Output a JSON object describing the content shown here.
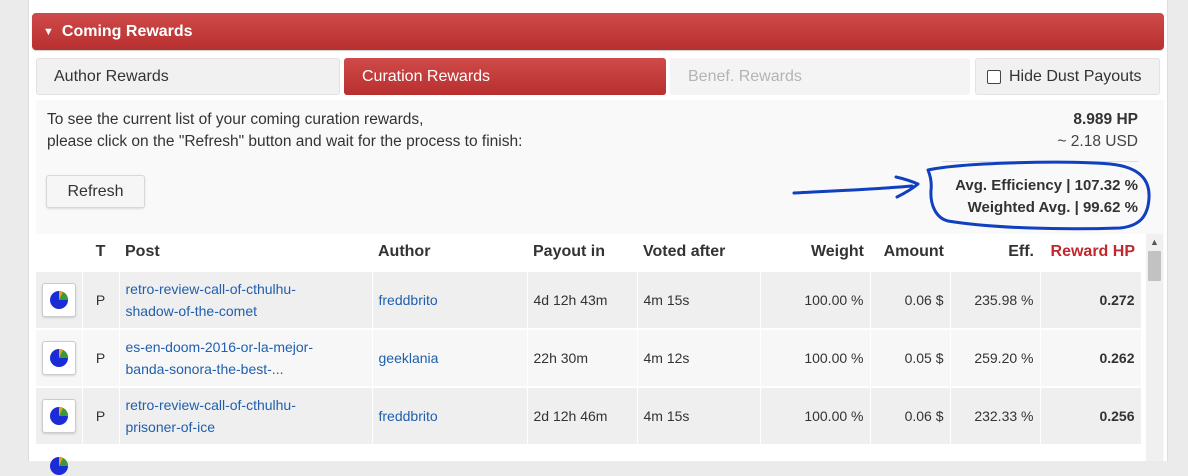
{
  "panel": {
    "title": "Coming Rewards"
  },
  "tabs": [
    {
      "label": "Author Rewards"
    },
    {
      "label": "Curation Rewards"
    },
    {
      "label": "Benef. Rewards"
    },
    {
      "label": "Hide Dust Payouts"
    }
  ],
  "info": {
    "line1": "To see the current list of your coming curation rewards,",
    "line2": "please click on the \"Refresh\" button and wait for the process to finish:"
  },
  "totals": {
    "hp": "8.989 HP",
    "usd": "~ 2.18 USD"
  },
  "summary": {
    "avg_efficiency": "Avg. Efficiency | 107.32 %",
    "weighted_avg": "Weighted Avg. | 99.62 %"
  },
  "refresh_label": "Refresh",
  "table": {
    "headers": [
      "T",
      "Post",
      "Author",
      "Payout in",
      "Voted after",
      "Weight",
      "Amount",
      "Eff.",
      "Reward HP"
    ],
    "rows": [
      {
        "type": "P",
        "post_line1": "retro-review-call-of-cthulhu-",
        "post_line2": "shadow-of-the-comet",
        "author": "freddbrito",
        "payout_in": "4d 12h 43m",
        "voted_after": "4m 15s",
        "weight": "100.00 %",
        "amount": "0.06 $",
        "eff": "235.98 %",
        "reward_hp": "0.272"
      },
      {
        "type": "P",
        "post_line1": "es-en-doom-2016-or-la-mejor-",
        "post_line2": "banda-sonora-the-best-...",
        "author": "geeklania",
        "payout_in": "22h 30m",
        "voted_after": "4m 12s",
        "weight": "100.00 %",
        "amount": "0.05 $",
        "eff": "259.20 %",
        "reward_hp": "0.262"
      },
      {
        "type": "P",
        "post_line1": "retro-review-call-of-cthulhu-",
        "post_line2": "prisoner-of-ice",
        "author": "freddbrito",
        "payout_in": "2d 12h 46m",
        "voted_after": "4m 15s",
        "weight": "100.00 %",
        "amount": "0.06 $",
        "eff": "232.33 %",
        "reward_hp": "0.256"
      }
    ]
  },
  "colors": {
    "accent_red": "#c0282d",
    "link_blue": "#1f5fae",
    "annotation_blue": "#1040c0"
  }
}
